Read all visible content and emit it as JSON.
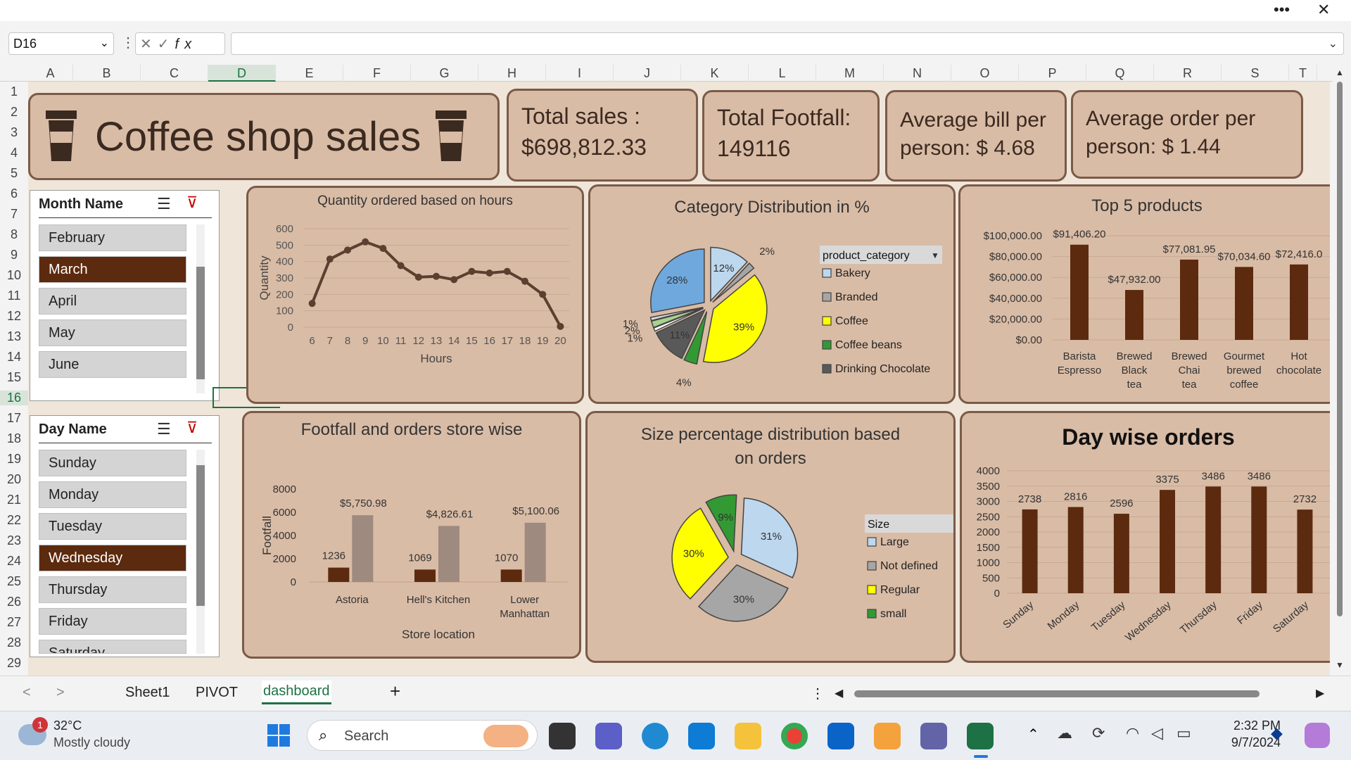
{
  "window": {
    "more_label": "•••",
    "close_label": "✕"
  },
  "formula": {
    "name_box": "D16",
    "fx": "fx",
    "value": ""
  },
  "columns": [
    "A",
    "B",
    "C",
    "D",
    "E",
    "F",
    "G",
    "H",
    "I",
    "J",
    "K",
    "L",
    "M",
    "N",
    "O",
    "P",
    "Q",
    "R",
    "S",
    "T"
  ],
  "rows": [
    "1",
    "2",
    "3",
    "4",
    "5",
    "6",
    "7",
    "8",
    "9",
    "10",
    "11",
    "12",
    "13",
    "14",
    "15",
    "16",
    "17",
    "18",
    "19",
    "20",
    "21",
    "22",
    "23",
    "24",
    "25",
    "26",
    "27",
    "28",
    "29"
  ],
  "header": {
    "title": "Coffee shop sales",
    "total_sales_label": "Total sales :",
    "total_sales_value": "$698,812.33",
    "footfall_label": "Total Footfall:",
    "footfall_value": "149116",
    "avg_bill_label": "Average bill per",
    "avg_bill_value": "person: $ 4.68",
    "avg_order_label": "Average order per",
    "avg_order_value": "person: $ 1.44"
  },
  "slicers": {
    "month": {
      "title": "Month Name",
      "items": [
        "February",
        "March",
        "April",
        "May",
        "June"
      ],
      "selected": "March"
    },
    "day": {
      "title": "Day Name",
      "items": [
        "Sunday",
        "Monday",
        "Tuesday",
        "Wednesday",
        "Thursday",
        "Friday",
        "Saturday"
      ],
      "selected": "Wednesday"
    }
  },
  "chart_data": [
    {
      "id": "hours",
      "type": "line",
      "title": "Quantity ordered based on hours",
      "xlabel": "Hours",
      "ylabel": "Quantity",
      "x": [
        6,
        7,
        8,
        9,
        10,
        11,
        12,
        13,
        14,
        15,
        16,
        17,
        18,
        19,
        20
      ],
      "values": [
        145,
        415,
        470,
        520,
        480,
        375,
        305,
        310,
        290,
        340,
        330,
        340,
        280,
        200,
        5
      ],
      "ylim": [
        0,
        600
      ],
      "yticks": [
        0,
        100,
        200,
        300,
        400,
        500,
        600
      ],
      "color": "#5b4030"
    },
    {
      "id": "category",
      "type": "pie",
      "title": "Category Distribution in %",
      "legend_title": "product_category",
      "legend": [
        "Bakery",
        "Branded",
        "Coffee",
        "Coffee beans",
        "Drinking Chocolate"
      ],
      "labels": [
        "12%",
        "2%",
        "39%",
        "4%",
        "11%",
        "1%",
        "2%",
        "1%",
        "28%"
      ],
      "values": [
        12,
        2,
        39,
        4,
        11,
        1,
        2,
        1,
        28
      ],
      "colors": [
        "#bdd7ee",
        "#a6a6a6",
        "#ffff00",
        "#339933",
        "#595959",
        "#ffffff",
        "#a9d18e",
        "#d9d9d9",
        "#6fa8dc"
      ]
    },
    {
      "id": "top5",
      "type": "bar",
      "title": "Top 5 products",
      "categories": [
        "Barista Espresso",
        "Brewed Black tea",
        "Brewed Chai tea",
        "Gourmet brewed coffee",
        "Hot chocolate"
      ],
      "values": [
        91406.2,
        47932.0,
        77081.95,
        70034.6,
        72416.0
      ],
      "value_labels": [
        "$91,406.20",
        "$47,932.00",
        "$77,081.95",
        "$70,034.60",
        "$72,416.0"
      ],
      "yticks": [
        "$0.00",
        "$20,000.00",
        "$40,000.00",
        "$60,000.00",
        "$80,000.00",
        "$100,000.00"
      ],
      "ylim": [
        0,
        100000
      ],
      "color": "#5c2a0e"
    },
    {
      "id": "store",
      "type": "bar",
      "title": "Footfall and orders store wise",
      "xlabel": "Store location",
      "ylabel": "Footfall",
      "categories": [
        "Astoria",
        "Hell's Kitchen",
        "Lower Manhattan"
      ],
      "series": [
        {
          "values": [
            1236,
            1069,
            1070
          ],
          "labels": [
            "1236",
            "1069",
            "1070"
          ],
          "color": "#5c2a0e"
        },
        {
          "values": [
            5750.98,
            4826.61,
            5100.06
          ],
          "labels": [
            "$5,750.98",
            "$4,826.61",
            "$5,100.06"
          ],
          "color": "#9e8a7f"
        }
      ],
      "yticks": [
        0,
        2000,
        4000,
        6000,
        8000
      ],
      "ylim": [
        0,
        8000
      ]
    },
    {
      "id": "size",
      "type": "pie",
      "title": "Size percentage distribution based on orders",
      "legend_title": "Size",
      "legend": [
        "Large",
        "Not defined",
        "Regular",
        "small"
      ],
      "labels": [
        "31%",
        "30%",
        "30%",
        "9%"
      ],
      "values": [
        31,
        30,
        30,
        9
      ],
      "colors": [
        "#bdd7ee",
        "#a6a6a6",
        "#ffff00",
        "#339933"
      ]
    },
    {
      "id": "days",
      "type": "bar",
      "title": "Day wise orders",
      "categories": [
        "Sunday",
        "Monday",
        "Tuesday",
        "Wednesday",
        "Thursday",
        "Friday",
        "Saturday"
      ],
      "values": [
        2738,
        2816,
        2596,
        3375,
        3486,
        3486,
        2732
      ],
      "value_labels": [
        "2738",
        "2816",
        "2596",
        "3375",
        "3486",
        "3486",
        "2732"
      ],
      "yticks": [
        0,
        500,
        1000,
        1500,
        2000,
        2500,
        3000,
        3500,
        4000
      ],
      "ylim": [
        0,
        4000
      ],
      "color": "#5c2a0e"
    }
  ],
  "tabs": {
    "items": [
      "Sheet1",
      "PIVOT",
      "dashboard"
    ],
    "active": "dashboard",
    "add": "+"
  },
  "taskbar": {
    "temp": "32°C",
    "weather": "Mostly cloudy",
    "badge": "1",
    "search": "Search",
    "time": "2:32 PM",
    "date": "9/7/2024"
  }
}
